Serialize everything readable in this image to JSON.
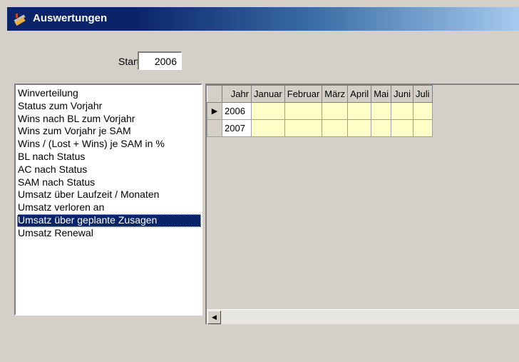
{
  "window": {
    "title": "Auswertungen",
    "icon": "app-broom-icon"
  },
  "start": {
    "label": "Startjahr",
    "value": "2006"
  },
  "reports": {
    "items": [
      "Winverteilung",
      "Status zum Vorjahr",
      "Wins nach BL zum Vorjahr",
      "Wins zum Vorjahr je SAM",
      "Wins / (Lost + Wins)  je SAM in %",
      "BL nach Status",
      "AC nach Status",
      "SAM nach Status",
      "Umsatz über Laufzeit / Monaten",
      "Umsatz verloren an",
      "Umsatz über geplante Zusagen",
      "Umsatz Renewal"
    ],
    "selected_index": 10
  },
  "grid": {
    "columns": [
      "Jahr",
      "Januar",
      "Februar",
      "März",
      "April",
      "Mai",
      "Juni",
      "Juli"
    ],
    "rows": [
      {
        "year": "2006",
        "current": true
      },
      {
        "year": "2007",
        "current": false
      }
    ],
    "current_row_icon": "row-pointer-icon",
    "scroll_left_icon": "scroll-left-arrow-icon"
  },
  "colors": {
    "selection": "#0a246a",
    "cell_bg": "#ffffc8",
    "title_start": "#0a246a"
  }
}
